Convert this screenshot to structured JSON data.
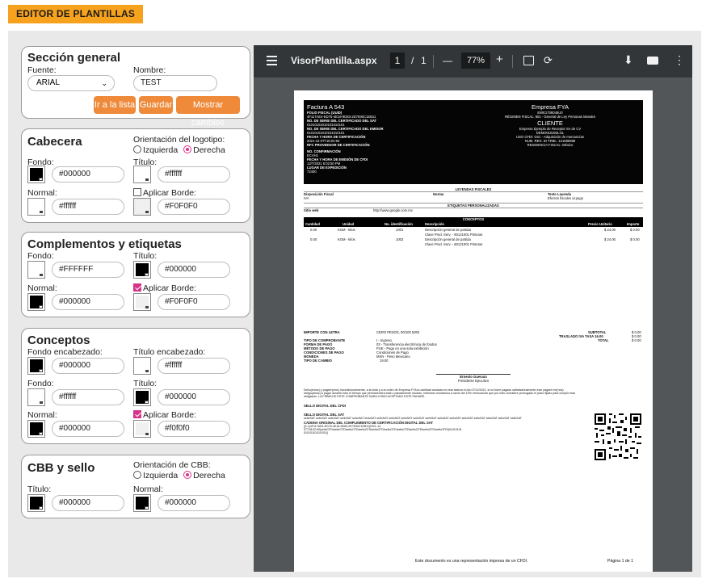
{
  "header": {
    "title": "EDITOR DE PLANTILLAS"
  },
  "colors": {
    "accent": "#f6a21e",
    "button": "#ee8a3a",
    "radio": "#d6338a",
    "viewer_bg": "#525659",
    "toolbar_bg": "#323639"
  },
  "general": {
    "title": "Sección general",
    "font_label": "Fuente:",
    "font_value": "ARIAL",
    "name_label": "Nombre:",
    "name_value": "TEST",
    "buttons": {
      "list": "Ir a la lista",
      "save": "Guardar",
      "preview": "Mostrar cambios"
    }
  },
  "cabecera": {
    "title": "Cabecera",
    "logo_orientation_label": "Orientación del logotipo:",
    "left": "Izquierda",
    "right": "Derecha",
    "fondo_label": "Fondo:",
    "fondo_value": "#000000",
    "titulo_label": "Título:",
    "titulo_value": "#ffffff",
    "normal_label": "Normal:",
    "normal_value": "#ffffff",
    "border_label": "Aplicar Borde:",
    "border_value": "#F0F0F0"
  },
  "complementos": {
    "title": "Complementos y etiquetas",
    "fondo_label": "Fondo:",
    "fondo_value": "#FFFFFF",
    "titulo_label": "Título:",
    "titulo_value": "#000000",
    "normal_label": "Normal:",
    "normal_value": "#000000",
    "border_label": "Aplicar Borde:",
    "border_value": "#F0F0F0"
  },
  "conceptos": {
    "title": "Conceptos",
    "fondo_enc_label": "Fondo encabezado:",
    "fondo_enc_value": "#000000",
    "titulo_enc_label": "Título encabezado:",
    "titulo_enc_value": "#ffffff",
    "fondo_label": "Fondo:",
    "fondo_value": "#ffffff",
    "titulo_label": "Título:",
    "titulo_value": "#000000",
    "normal_label": "Normal:",
    "normal_value": "#000000",
    "border_label": "Aplicar Borde:",
    "border_value": "#f0f0f0"
  },
  "cbb": {
    "title": "CBB y sello",
    "orientation_label": "Orientación de CBB:",
    "left": "Izquierda",
    "right": "Derecha",
    "titulo_label": "Título:",
    "titulo_value": "#000000",
    "normal_label": "Normal:",
    "normal_value": "#000000"
  },
  "viewer": {
    "filename": "VisorPlantilla.aspx",
    "page_current": "1",
    "page_sep": "/",
    "page_total": "1",
    "zoom": "77%",
    "minus": "—",
    "plus": "+"
  },
  "invoice": {
    "factura": "Factura A 543",
    "folio_fiscal_label": "FOLIO FISCAL (UUID)",
    "folio_fiscal": "4F117AE4-ED75-4E18-9D83-2D7830C1EB11",
    "serie_cert_label": "NO. DE SERIE DEL CERTIFICADO DEL SAT",
    "serie_cert": "01010101010101010101",
    "serie_emisor_label": "NO. DE SERIE DEL CERTIFICADO DEL EMISOR",
    "serie_emisor": "01010101010101010101",
    "fecha_cert_label": "FECHA Y HORA DE CERTIFICACIÓN",
    "fecha_cert": "2021-12-07T18:02:50",
    "rfc_prov_label": "RFC PROVEEDOR DE CERTIFICACIÓN",
    "confirmacion_label": "NO. CONFIRMACIÓN",
    "confirmacion": "ECVH1",
    "fecha_emision_label": "FECHA Y HORA DE EMISIÓN DE CFDI",
    "fecha_emision": "12/7/2021 6:02:50 PM",
    "lugar_label": "LUGAR DE EXPEDICIÓN",
    "lugar": "72400",
    "empresa": "Empresa FYA",
    "empresa_rfc": "EWE1709045U0",
    "regimen": "RÉGIMEN FISCAL: 601 - General de Ley Personas Morales",
    "cliente_title": "CLIENTE",
    "cliente_nombre": "Empresa Ejemplo de Receptor SA de CV",
    "cliente_rfc": "DEMO010203LOL",
    "uso_cfdi": "USO CFDI: G01 - Adquisición de mercancías",
    "num_reg": "NUM. REG. ID TRIB.: 121585958",
    "residencia": "RESIDENCIA FISCAL: México",
    "leyendas_title": "LEYENDAS FISCALES",
    "ley_h1": "Disposición Fiscal",
    "ley_h2": "Norma",
    "ley_h3": "Texto Leyenda",
    "ley_c1": "IVA",
    "ley_c3": "Efectos fiscales al pago",
    "etiquetas_title": "ETIQUETAS PERSONALIZADAS",
    "sitio_label": "Sitio web",
    "sitio": "http://www.google.com.mx",
    "conceptos_title": "CONCEPTOS",
    "col_cantidad": "Cantidad",
    "col_unidad": "Unidad",
    "col_id": "No. identificación",
    "col_desc": "Descripción",
    "col_precio": "Precio Unitario",
    "col_importe": "Importe",
    "items": [
      {
        "cantidad": "0.00",
        "unidad": "KGM - kilos",
        "id": "1001",
        "desc": "Descripción general de partida",
        "clave": "Clave Prod. Serv. - 60121001 Pinturas",
        "precio": "$ 24.00",
        "importe": "$ 0.00"
      },
      {
        "cantidad": "0.00",
        "unidad": "KGM - kilos",
        "id": "1002",
        "desc": "Descripción general de partida",
        "clave": "Clave Prod. Serv. - 60121001 Pinturas",
        "precio": "$ 24.00",
        "importe": "$ 0.00"
      }
    ],
    "importe_letra_label": "IMPORTE CON LETRA",
    "importe_letra": "CERO PESOS, 00/100 MXN",
    "subtotal_label": "SUBTOTAL",
    "subtotal": "$ 0.00",
    "iva_label": "TRASLADO IVA TASA 16.00",
    "iva": "$ 0.00",
    "total_label": "TOTAL",
    "total": "$ 0.00",
    "tipo_comp_label": "TIPO DE COMPROBANTE",
    "tipo_comp": "I - Ingreso",
    "forma_pago_label": "FORMA DE PAGO",
    "forma_pago": "03 - Transferencia electrónica de fondos",
    "metodo_pago_label": "MÉTODO DE PAGO",
    "metodo_pago": "PUE - Pago en una sola exhibición",
    "cond_pago_label": "CONDICIONES DE PAGO",
    "cond_pago": "Condiciones de Pago",
    "moneda_label": "MONEDA",
    "moneda": "MXN - Peso Mexicano",
    "tipo_cambio_label": "TIPO DE CAMBIO",
    "tipo_cambio": "19.00",
    "firma_nombre": "Ernesto Guevara",
    "firma_cargo": "Presidente Ejecutivo",
    "pagare_1": "Debo(emos) y pagaré(mos) incondicionalmente, a la vista y a la orden de Empresa FYA la cantidad anotada en esta factura el día 07/12/2021, si no fuere pagado satisfactoriamente este pagaré me(nos)",
    "pagare_2": "obligo(amos) a pagar durante todo el tiempo que permaneciera total o parcialmente insoluto, intereses moratorios a razón del 10% mensual sin que por esto considere prorrogado el plazo fijado para cumplir esta",
    "pagare_3": "obligación. LA FIRMA DE ESTE COMPROBANTE DARA COMO ACEPTADO ESTE PAGARE.",
    "sello_cfdi_label": "SELLO DIGITAL DEL CFDI",
    "sello_sat_label": "SELLO DIGITAL DEL SAT",
    "sello_sat": "selloSAT selloSAT selloSAT selloSAT selloSAT selloSAT selloSAT selloSAT selloSAT selloSAT selloSAT selloSAT selloSAT selloSAT selloSAT selloSAT selloSAT selloSAT",
    "cadena_label": "CADENA ORIGINAL DEL COMPLEMENTO DE CERTIFICACIÓN DIGITAL DEL SAT",
    "cadena_1": "||1.1|4F117AE4-ED75-4E18-9D83-2D7830C1EB11|2021-12-",
    "cadena_2": "07T18:02:50|selloCFDIselloCFDIselloCFDIselloCFDIselloCFDIselloCFDIselloCFDIselloCFDIselloCFDIselloCFDI|01010101",
    "cadena_3": "01010101010101||",
    "footer_note": "Este documento es una representación impresa de un CFDI.",
    "footer_page": "Página 1 de 1"
  }
}
